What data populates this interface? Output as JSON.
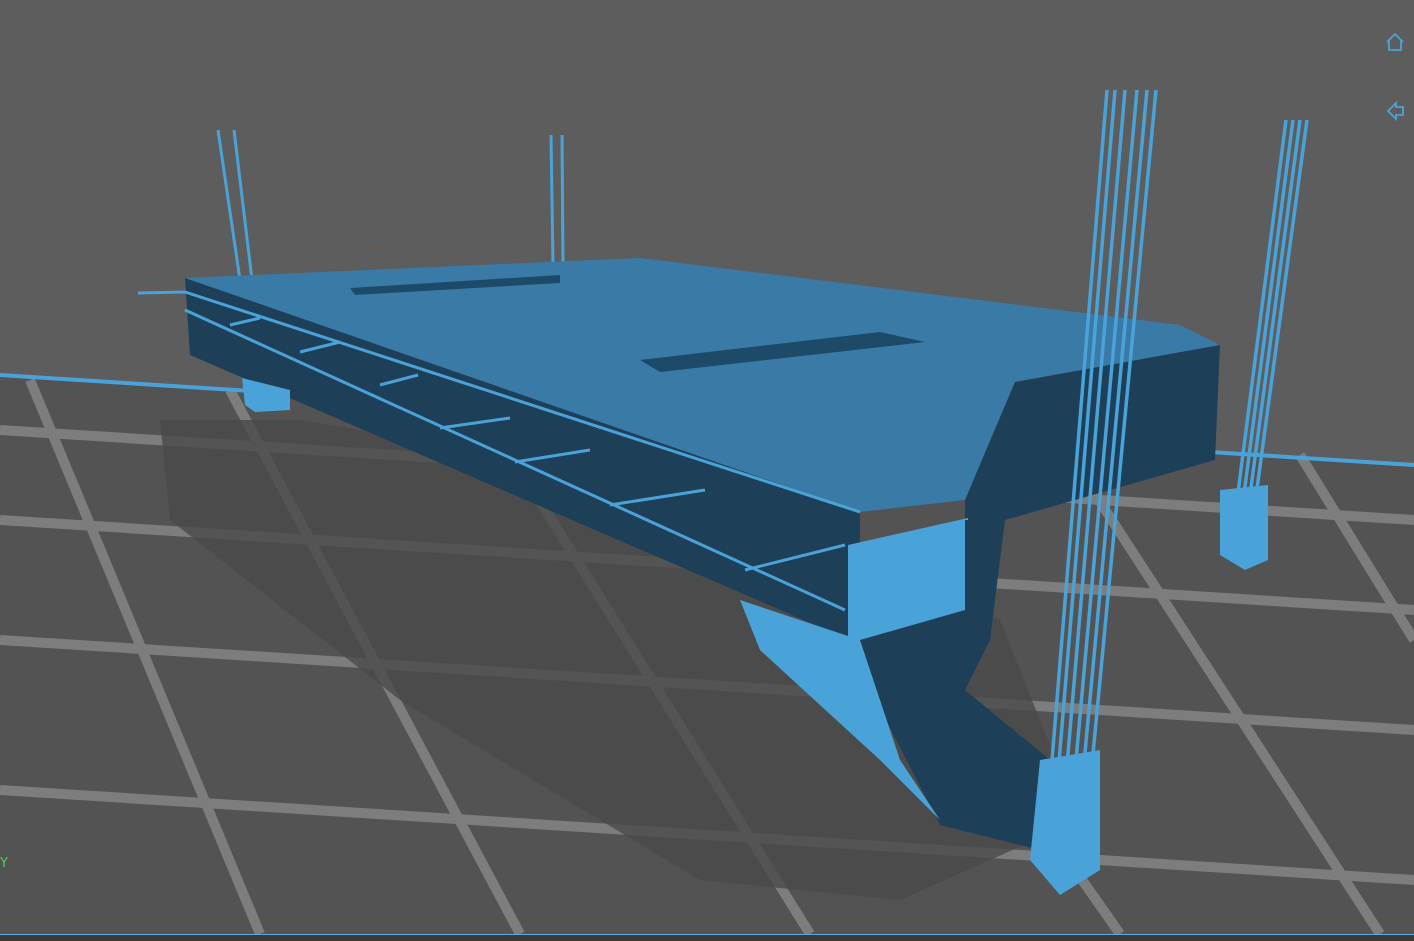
{
  "viewport": {
    "type": "3d-model-viewer",
    "model_color": "#4aa3d8",
    "model_shadow_color": "#1f4f6e",
    "background_color": "#5d5d5d",
    "grid_color": "#7a7a7a"
  },
  "toolbar": {
    "buttons": [
      {
        "icon": "home-icon"
      },
      {
        "icon": "back-arrow-icon"
      }
    ]
  },
  "axis_indicator": {
    "label": "Y",
    "color": "#4fd04f"
  }
}
